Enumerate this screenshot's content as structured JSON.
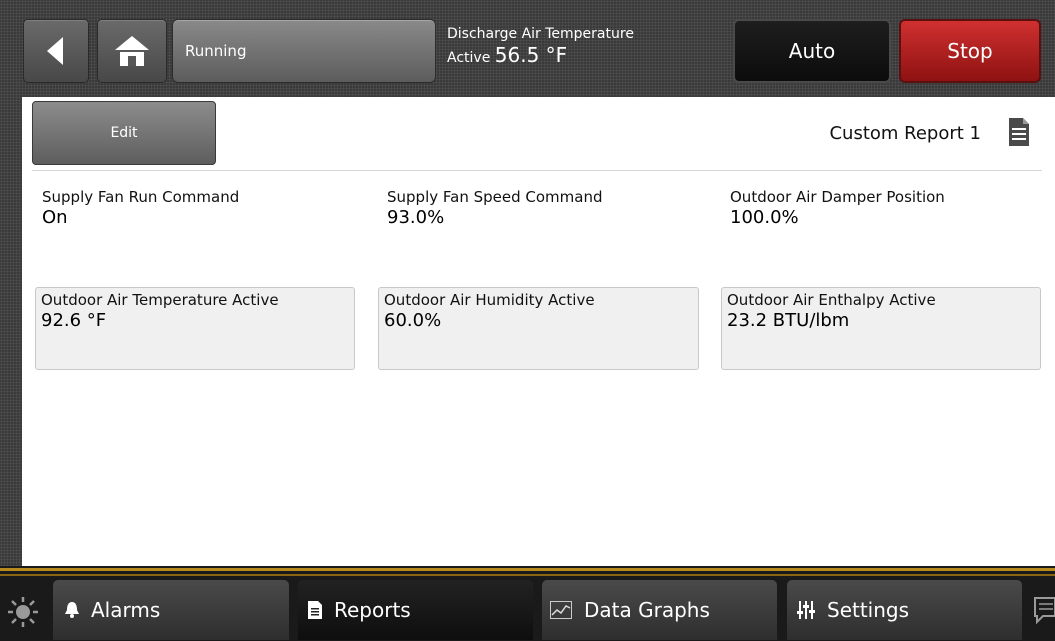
{
  "header": {
    "status": "Running",
    "discharge_label": "Discharge Air Temperature",
    "discharge_active_label": "Active",
    "discharge_value": "56.5 °F",
    "auto_label": "Auto",
    "stop_label": "Stop",
    "icons": [
      "back-arrow-icon",
      "home-icon"
    ]
  },
  "toolbar": {
    "edit_label": "Edit",
    "report_title": "Custom Report 1",
    "report_icon": "document-icon"
  },
  "points": [
    {
      "label": "Supply Fan Run Command",
      "value": "On"
    },
    {
      "label": "Supply Fan Speed Command",
      "value": "93.0%"
    },
    {
      "label": "Outdoor Air Damper Position",
      "value": "100.0%"
    },
    {
      "label": "Outdoor Air Temperature Active",
      "value": "92.6 °F"
    },
    {
      "label": "Outdoor Air Humidity Active",
      "value": "60.0%"
    },
    {
      "label": "Outdoor Air Enthalpy Active",
      "value": "23.2 BTU/lbm"
    }
  ],
  "nav": {
    "tabs": [
      {
        "label": "Alarms",
        "icon": "bell-icon"
      },
      {
        "label": "Reports",
        "icon": "document-icon",
        "active": true
      },
      {
        "label": "Data Graphs",
        "icon": "line-graph-icon"
      },
      {
        "label": "Settings",
        "icon": "sliders-icon"
      }
    ],
    "left_icon": "sun-icon",
    "right_icon": "chat-icon"
  },
  "colors": {
    "stop": "#c02020",
    "accent_gold": "#b88a1e",
    "content_bg": "#ffffff"
  }
}
